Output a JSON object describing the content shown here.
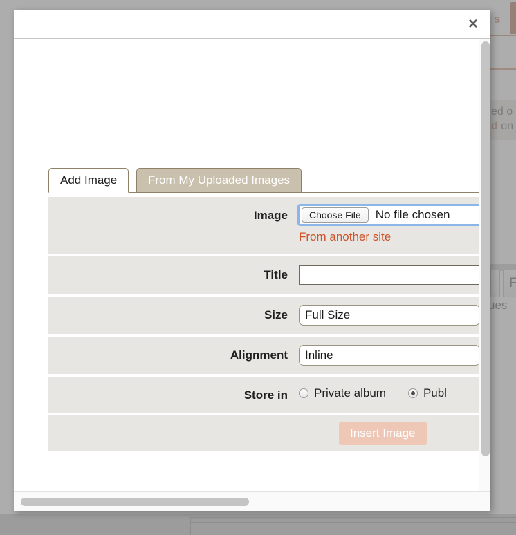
{
  "background": {
    "tab_label_fragment": "s",
    "notice_line1": "ed o",
    "notice_line2_bold": "d",
    "notice_line2_rest": " on",
    "toolbar_button_label": "F",
    "text_fragment": "ues"
  },
  "modal": {
    "close_icon": "×",
    "tabs": [
      {
        "label": "Add Image",
        "active": true
      },
      {
        "label": "From My Uploaded Images",
        "active": false
      }
    ],
    "form": {
      "image": {
        "label": "Image",
        "choose_file_button": "Choose File",
        "file_status": "No file chosen",
        "from_another_site_link": "From another site"
      },
      "title": {
        "label": "Title",
        "value": "",
        "placeholder": ""
      },
      "size": {
        "label": "Size",
        "selected": "Full Size"
      },
      "alignment": {
        "label": "Alignment",
        "selected": "Inline"
      },
      "store_in": {
        "label": "Store in",
        "options": [
          {
            "label": "Private album",
            "selected": false
          },
          {
            "label": "Publ",
            "selected": true
          }
        ]
      },
      "submit": {
        "label": "Insert Image"
      }
    }
  },
  "colors": {
    "link_orange": "#cf5129",
    "tab_inactive_bg": "#c9c0ad",
    "tab_border": "#8f8268",
    "row_bg": "#e8e6e2",
    "submit_bg": "#eec7b7",
    "focus_ring": "#8cb6e8"
  }
}
